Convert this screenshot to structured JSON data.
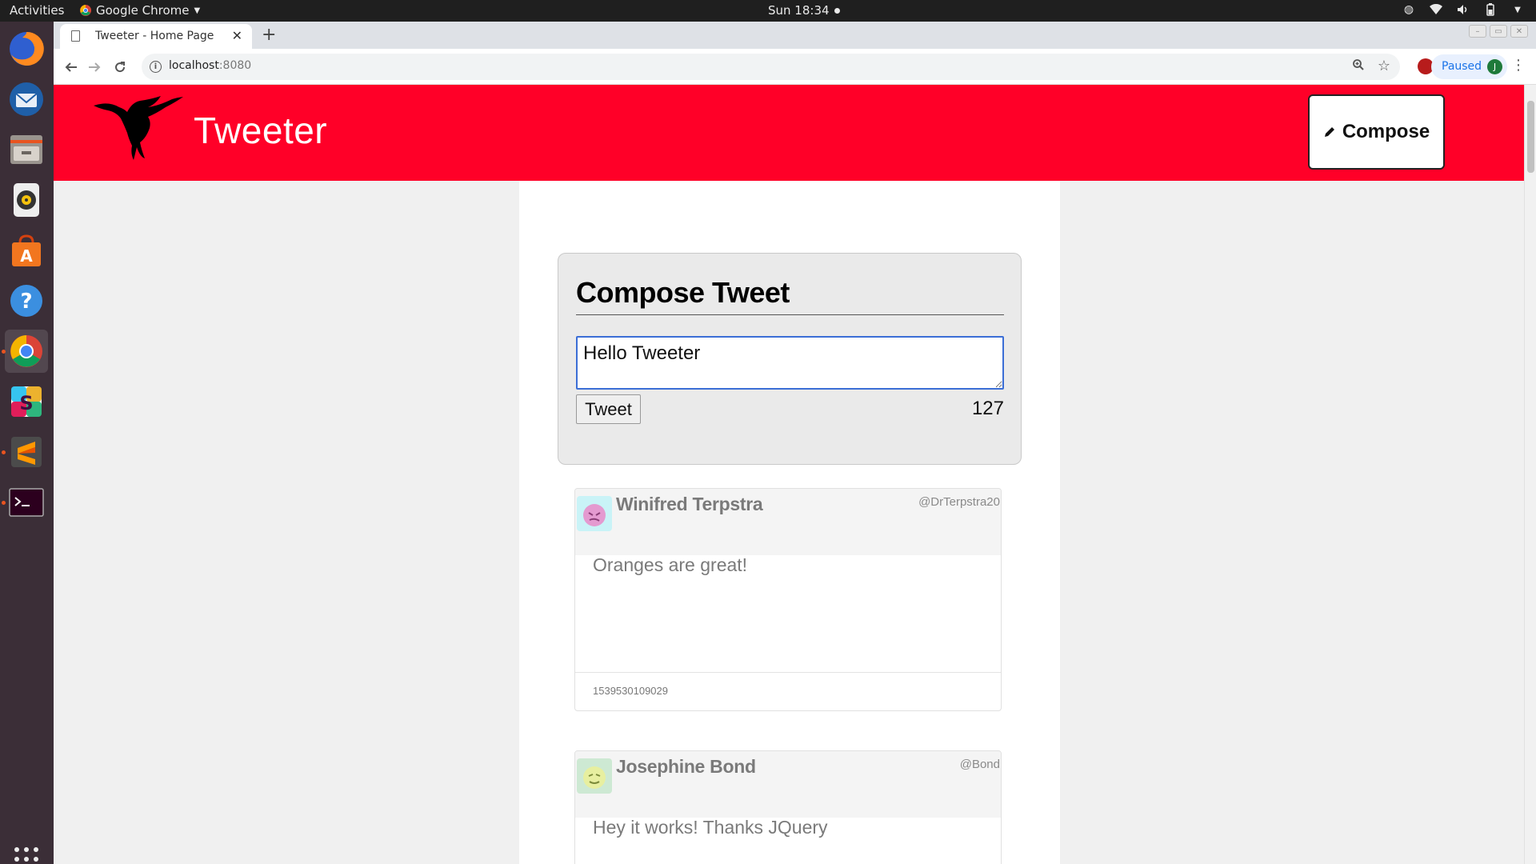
{
  "os": {
    "activities_label": "Activities",
    "app_menu_label": "Google Chrome",
    "clock": "Sun 18:34"
  },
  "browser": {
    "tab_title": "Tweeter - Home Page",
    "url_host": "localhost",
    "url_port": ":8080",
    "profile_status": "Paused",
    "profile_initial": "J"
  },
  "site": {
    "brand": "Tweeter",
    "compose_toggle_label": "Compose",
    "accent_color": "#ff0028"
  },
  "composer": {
    "heading": "Compose Tweet",
    "textarea_value": "Hello Tweeter",
    "submit_label": "Tweet",
    "chars_remaining": "127"
  },
  "tweets": [
    {
      "name": "Winifred Terpstra",
      "handle": "@DrTerpstra20",
      "text": "Oranges are great!",
      "timestamp": "1539530109029"
    },
    {
      "name": "Josephine Bond",
      "handle": "@Bond",
      "text": "Hey it works! Thanks JQuery"
    }
  ]
}
